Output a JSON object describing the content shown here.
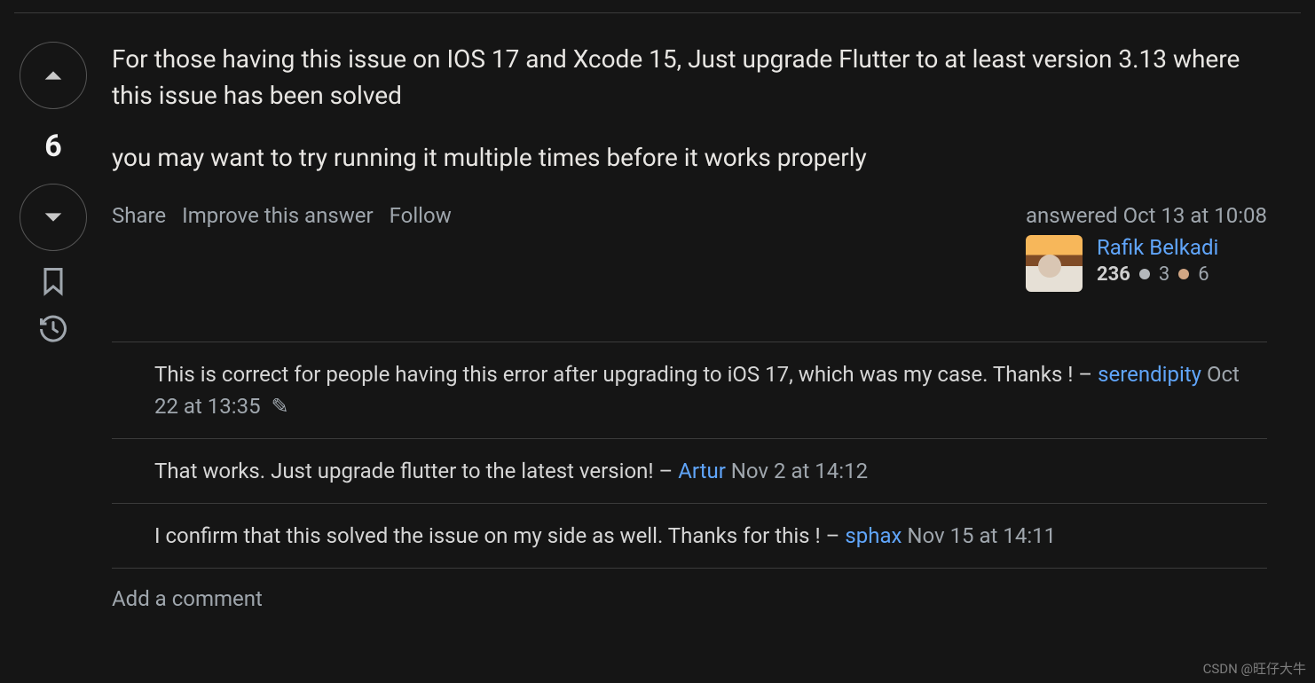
{
  "vote": {
    "score": "6"
  },
  "answer": {
    "p1": "For those having this issue on IOS 17 and Xcode 15, Just upgrade Flutter to at least version 3.13 where this issue has been solved",
    "p2": "you may want to try running it multiple times before it works properly"
  },
  "actions": {
    "share": "Share",
    "improve": "Improve this answer",
    "follow": "Follow"
  },
  "author": {
    "answered_label": "answered Oct 13 at 10:08",
    "name": "Rafik Belkadi",
    "rep": "236",
    "silver": "3",
    "bronze": "6"
  },
  "comments": [
    {
      "text": "This is correct for people having this error after upgrading to iOS 17, which was my case. Thanks !",
      "user": "serendipity",
      "time": "Oct 22 at 13:35",
      "edited": true
    },
    {
      "text": "That works. Just upgrade flutter to the latest version!",
      "user": "Artur",
      "time": "Nov 2 at 14:12",
      "edited": false
    },
    {
      "text": "I confirm that this solved the issue on my side as well. Thanks for this !",
      "user": "sphax",
      "time": "Nov 15 at 14:11",
      "edited": false
    }
  ],
  "add_comment": "Add a comment",
  "watermark": "CSDN @旺仔大牛"
}
